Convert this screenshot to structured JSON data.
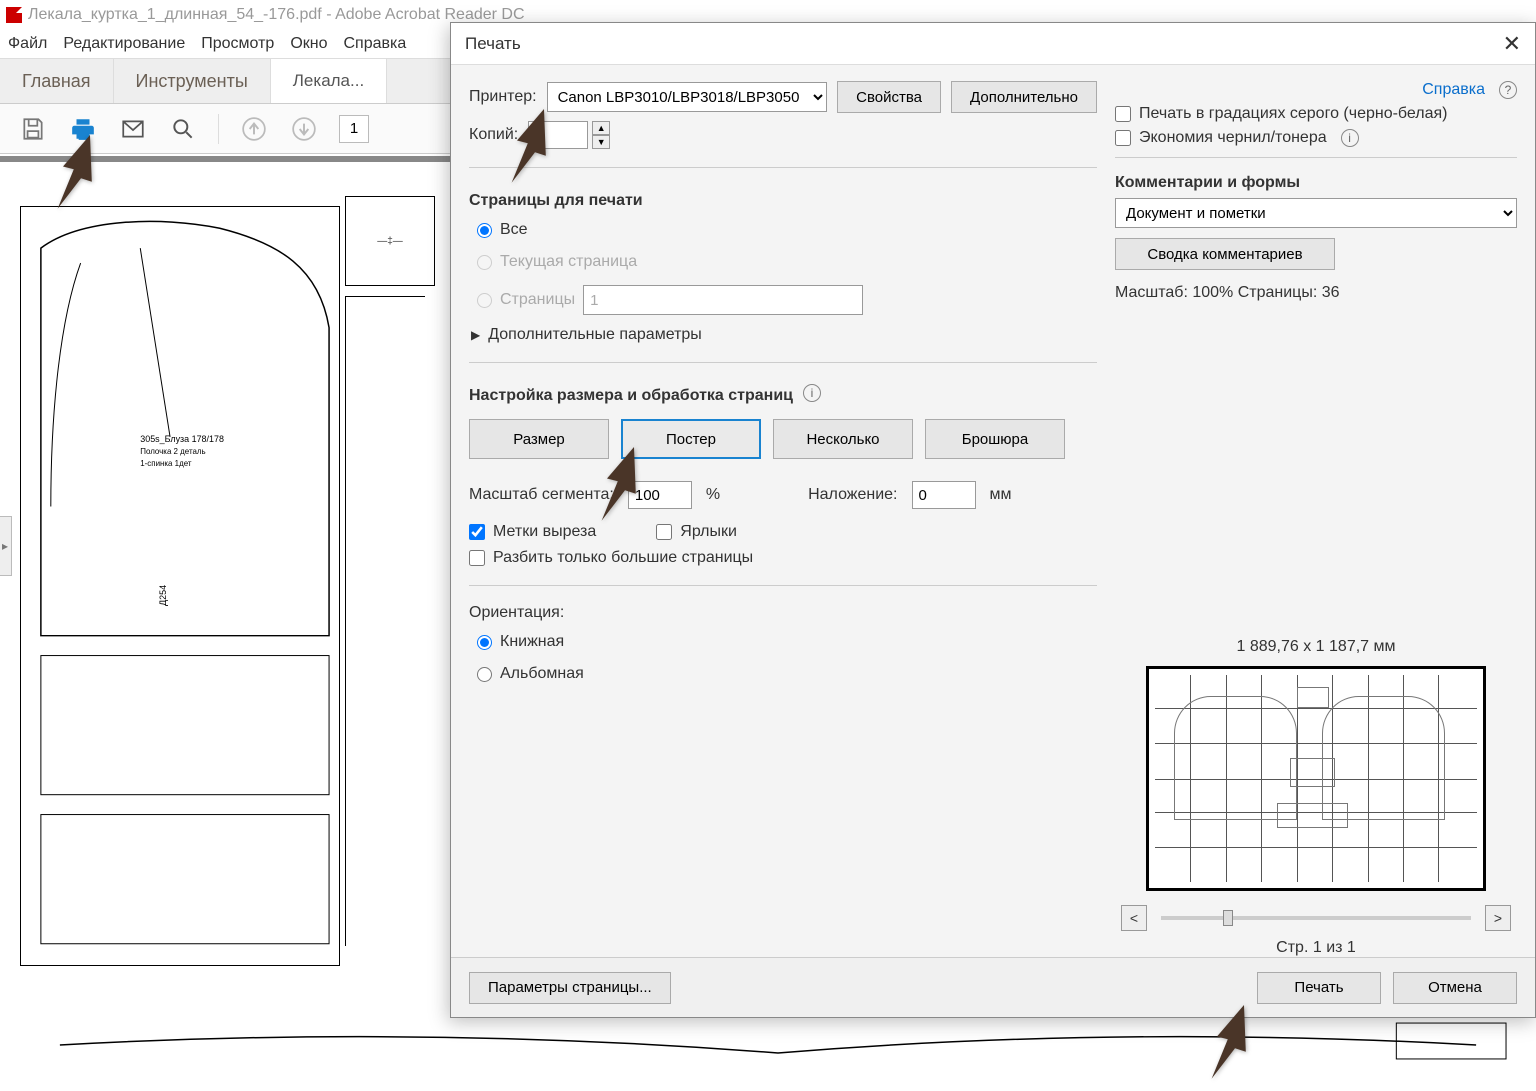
{
  "window": {
    "title": "Лекала_куртка_1_длинная_54_-176.pdf - Adobe Acrobat Reader DC"
  },
  "menu": {
    "file": "Файл",
    "edit": "Редактирование",
    "view": "Просмотр",
    "window": "Окно",
    "help": "Справка"
  },
  "tabs": {
    "home": "Главная",
    "tools": "Инструменты",
    "doc": "Лекала..."
  },
  "toolbar": {
    "page": "1"
  },
  "print": {
    "title": "Печать",
    "printer_label": "Принтер:",
    "printer_value": "Canon LBP3010/LBP3018/LBP3050",
    "properties": "Свойства",
    "advanced": "Дополнительно",
    "help": "Справка",
    "copies_label": "Копий:",
    "copies_value": "",
    "grayscale": "Печать в градациях серого (черно-белая)",
    "save_ink": "Экономия чернил/тонера",
    "pages_section": "Страницы для печати",
    "all": "Все",
    "current": "Текущая страница",
    "pages": "Страницы",
    "pages_value": "1",
    "more_params": "Дополнительные параметры",
    "size_section": "Настройка размера и обработка страниц",
    "b_size": "Размер",
    "b_poster": "Постер",
    "b_multi": "Несколько",
    "b_booklet": "Брошюра",
    "tile_scale": "Масштаб сегмента:",
    "tile_scale_val": "100",
    "percent": "%",
    "overlap": "Наложение:",
    "overlap_val": "0",
    "mm": "мм",
    "cut_marks": "Метки выреза",
    "labels": "Ярлыки",
    "only_large": "Разбить только большие страницы",
    "orientation": "Ориентация:",
    "portrait": "Книжная",
    "landscape": "Альбомная",
    "comments_section": "Комментарии и формы",
    "doc_and_marks": "Документ и пометки",
    "summarize": "Сводка комментариев",
    "scale_info": "Масштаб: 100% Страницы: 36",
    "preview_dims": "1 889,76 x 1 187,7 мм",
    "page_of": "Стр. 1 из 1",
    "page_setup": "Параметры страницы...",
    "do_print": "Печать",
    "cancel": "Отмена",
    "nav_prev": "<",
    "nav_next": ">"
  }
}
